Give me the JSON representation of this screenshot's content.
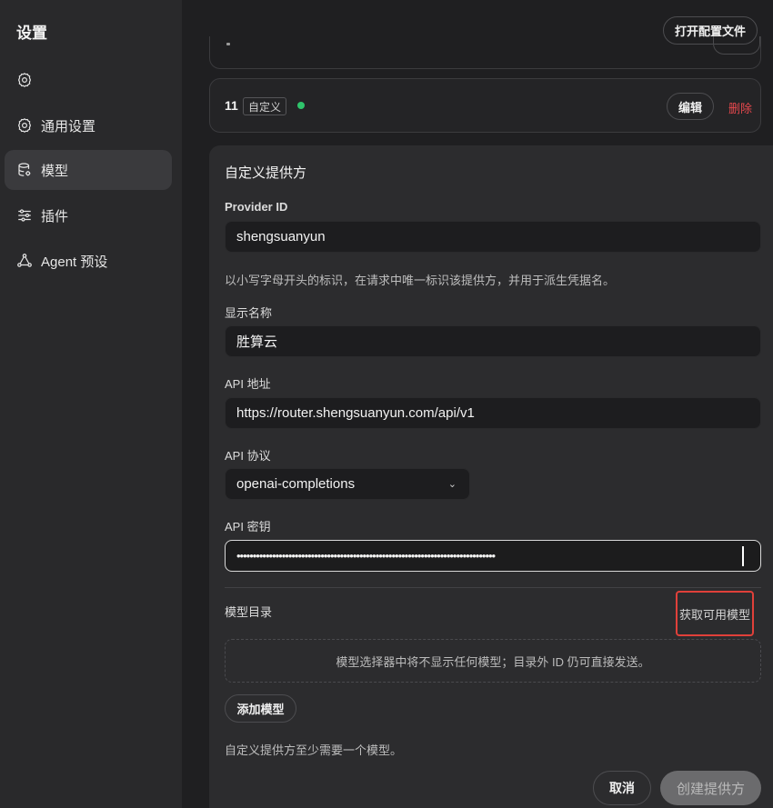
{
  "sidebar": {
    "title": "设置",
    "items": [
      {
        "label": ""
      },
      {
        "label": "通用设置"
      },
      {
        "label": "模型"
      },
      {
        "label": "插件"
      },
      {
        "label": "Agent 预设"
      }
    ]
  },
  "header": {
    "open_config": "打开配置文件"
  },
  "provider_row": {
    "number": "11",
    "tag": "自定义",
    "status_color": "#2fc46b",
    "edit": "编辑",
    "delete": "删除"
  },
  "form": {
    "title": "自定义提供方",
    "provider_id": {
      "label": "Provider ID",
      "value": "shengsuanyun",
      "hint": "以小写字母开头的标识，在请求中唯一标识该提供方，并用于派生凭据名。"
    },
    "display_name": {
      "label": "显示名称",
      "value": "胜算云"
    },
    "api_url": {
      "label": "API 地址",
      "value": "https://router.shengsuanyun.com/api/v1"
    },
    "api_protocol": {
      "label": "API 协议",
      "value": "openai-completions"
    },
    "api_key": {
      "label": "API 密钥",
      "value": "••••••••••••••••••••••••••••••••••••••••••••••••••••••••••••••••••••••••••••••••"
    },
    "model_catalog": {
      "label": "模型目录",
      "fetch_button": "获取可用模型",
      "empty_text": "模型选择器中将不显示任何模型；目录外 ID 仍可直接发送。",
      "add_button": "添加模型",
      "requirement": "自定义提供方至少需要一个模型。"
    },
    "cancel": "取消",
    "create": "创建提供方"
  },
  "colors": {
    "danger": "#e5484d",
    "highlight_box": "#e0403a"
  }
}
